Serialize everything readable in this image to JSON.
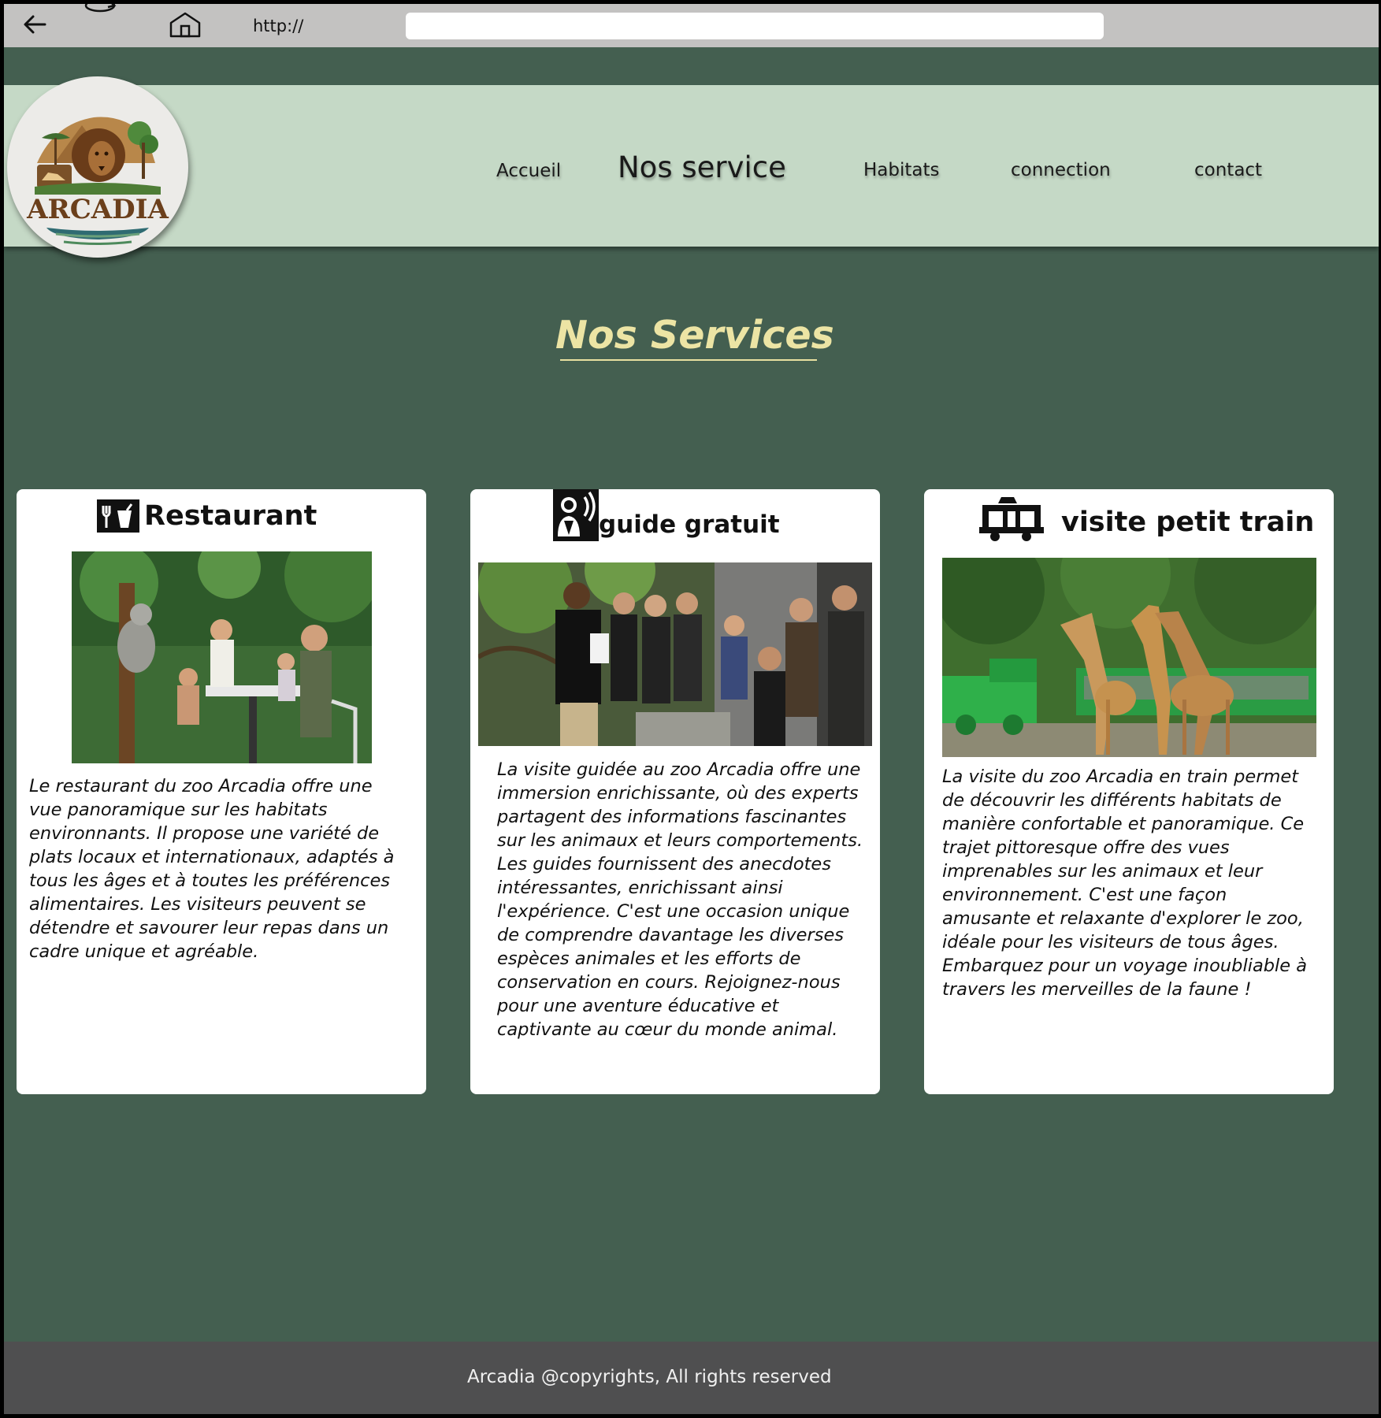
{
  "browser": {
    "url_label": "http://",
    "url_value": ""
  },
  "brand": {
    "logo_text": "ARCADIA"
  },
  "nav": {
    "items": [
      {
        "label": "Accueil"
      },
      {
        "label": "Nos service"
      },
      {
        "label": "Habitats"
      },
      {
        "label": "connection"
      },
      {
        "label": "contact"
      }
    ]
  },
  "page": {
    "title": "Nos Services"
  },
  "services": [
    {
      "title": "Restaurant",
      "icon": "restaurant-icon",
      "text": "Le restaurant du zoo Arcadia offre une vue panoramique sur les habitats environnants. Il propose une variété de plats locaux et internationaux, adaptés à tous les âges et à toutes les préférences alimentaires. Les visiteurs peuvent se détendre et savourer leur repas dans un cadre unique et agréable."
    },
    {
      "title": "guide gratuit",
      "icon": "guide-icon",
      "text": "La visite guidée au zoo Arcadia offre une immersion enrichissante, où des experts partagent des informations fascinantes sur les animaux et leurs comportements. Les guides fournissent des anecdotes intéressantes, enrichissant ainsi l'expérience. C'est une occasion unique de comprendre davantage les diverses espèces animales et les efforts de conservation en cours. Rejoignez-nous pour une aventure éducative et captivante au cœur du monde animal."
    },
    {
      "title": "visite petit train",
      "icon": "train-icon",
      "text": "La visite du zoo Arcadia en train permet de découvrir les différents habitats de manière confortable et panoramique. Ce trajet pittoresque offre des vues imprenables sur les animaux et leur environnement. C'est une façon amusante et relaxante d'explorer le zoo, idéale pour les visiteurs de tous âges. Embarquez pour un voyage inoubliable à travers les merveilles de la faune !"
    }
  ],
  "footer": {
    "text": "Arcadia @copyrights, All rights reserved"
  },
  "colors": {
    "page_bg": "#445f50",
    "header_bg": "#c5d9c6",
    "title": "#ece4a4",
    "footer_bg": "#4f4f50"
  }
}
